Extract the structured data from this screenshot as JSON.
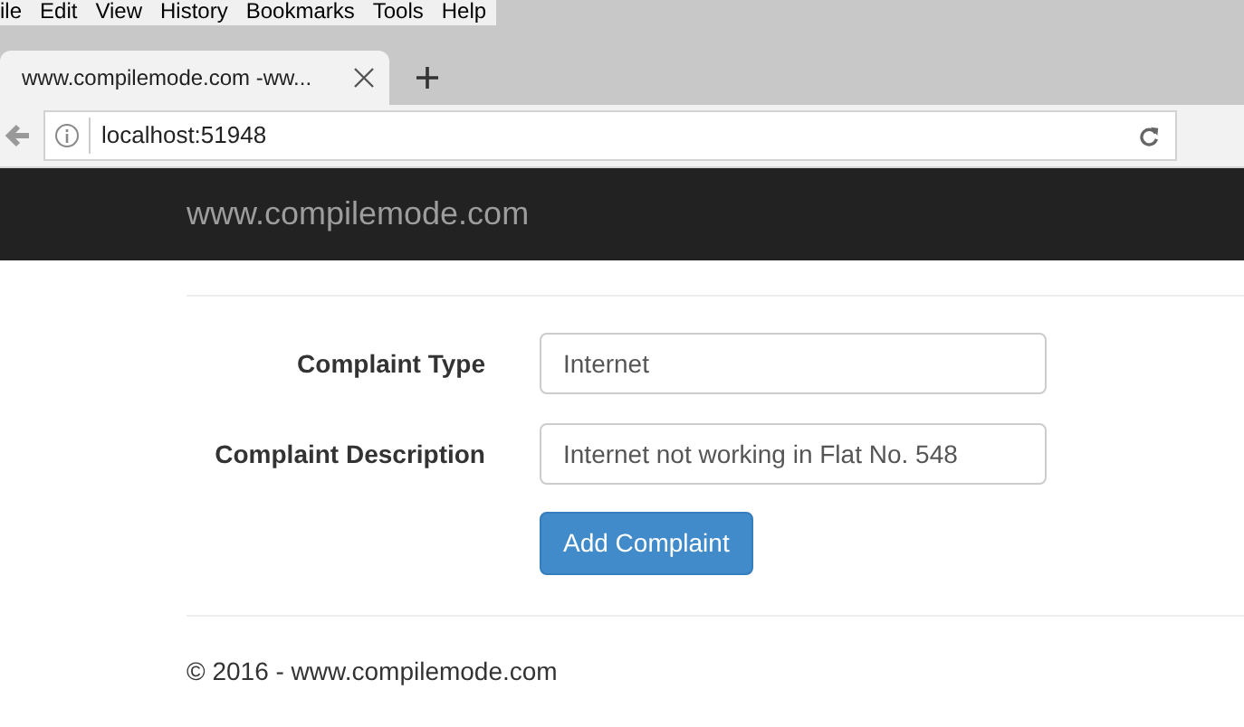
{
  "menu_bar": [
    "ile",
    "Edit",
    "View",
    "History",
    "Bookmarks",
    "Tools",
    "Help"
  ],
  "tabs": [
    {
      "label": "www.compilemode.com -ww...",
      "selected": true
    }
  ],
  "address_bar": {
    "url": "localhost:51948"
  },
  "navbar": {
    "brand": "www.compilemode.com"
  },
  "form": {
    "fields": [
      {
        "label": "Complaint Type",
        "value": "Internet"
      },
      {
        "label": "Complaint Description",
        "value": "Internet not working in Flat No. 548"
      }
    ],
    "submit": "Add Complaint"
  },
  "footer": "© 2016 - www.compilemode.com"
}
